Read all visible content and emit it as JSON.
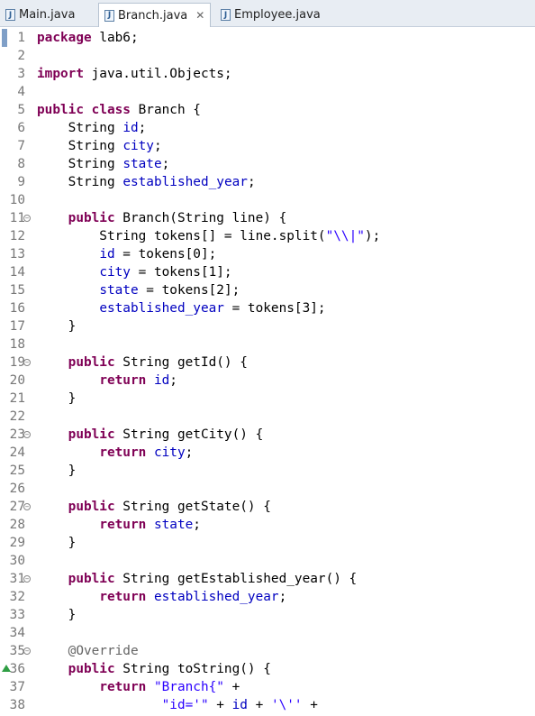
{
  "tabs": [
    {
      "label": "Main.java",
      "active": false
    },
    {
      "label": "Branch.java",
      "active": true,
      "close": "✕"
    },
    {
      "label": "Employee.java",
      "active": false
    }
  ],
  "tab_icon_glyph": "J",
  "lines": [
    {
      "n": "1",
      "parts": [
        {
          "t": "package",
          "c": "kw"
        },
        {
          "t": " lab6;"
        }
      ]
    },
    {
      "n": "2",
      "parts": []
    },
    {
      "n": "3",
      "parts": [
        {
          "t": "import",
          "c": "kw"
        },
        {
          "t": " java.util.Objects;"
        }
      ]
    },
    {
      "n": "4",
      "parts": []
    },
    {
      "n": "5",
      "parts": [
        {
          "t": "public",
          "c": "kw"
        },
        {
          "t": " "
        },
        {
          "t": "class",
          "c": "kw"
        },
        {
          "t": " Branch {"
        }
      ]
    },
    {
      "n": "6",
      "parts": [
        {
          "t": "    String "
        },
        {
          "t": "id",
          "c": "fld"
        },
        {
          "t": ";"
        }
      ]
    },
    {
      "n": "7",
      "parts": [
        {
          "t": "    String "
        },
        {
          "t": "city",
          "c": "fld"
        },
        {
          "t": ";"
        }
      ]
    },
    {
      "n": "8",
      "parts": [
        {
          "t": "    String "
        },
        {
          "t": "state",
          "c": "fld"
        },
        {
          "t": ";"
        }
      ]
    },
    {
      "n": "9",
      "parts": [
        {
          "t": "    String "
        },
        {
          "t": "established_year",
          "c": "fld"
        },
        {
          "t": ";"
        }
      ]
    },
    {
      "n": "10",
      "parts": []
    },
    {
      "n": "11",
      "fold": true,
      "parts": [
        {
          "t": "    "
        },
        {
          "t": "public",
          "c": "kw"
        },
        {
          "t": " Branch(String line) {"
        }
      ]
    },
    {
      "n": "12",
      "parts": [
        {
          "t": "        String tokens[] = line.split("
        },
        {
          "t": "\"\\\\|\"",
          "c": "str"
        },
        {
          "t": ");"
        }
      ]
    },
    {
      "n": "13",
      "parts": [
        {
          "t": "        "
        },
        {
          "t": "id",
          "c": "fld"
        },
        {
          "t": " = tokens[0];"
        }
      ]
    },
    {
      "n": "14",
      "parts": [
        {
          "t": "        "
        },
        {
          "t": "city",
          "c": "fld"
        },
        {
          "t": " = tokens[1];"
        }
      ]
    },
    {
      "n": "15",
      "parts": [
        {
          "t": "        "
        },
        {
          "t": "state",
          "c": "fld"
        },
        {
          "t": " = tokens[2];"
        }
      ]
    },
    {
      "n": "16",
      "parts": [
        {
          "t": "        "
        },
        {
          "t": "established_year",
          "c": "fld"
        },
        {
          "t": " = tokens[3];"
        }
      ]
    },
    {
      "n": "17",
      "parts": [
        {
          "t": "    }"
        }
      ]
    },
    {
      "n": "18",
      "parts": []
    },
    {
      "n": "19",
      "fold": true,
      "parts": [
        {
          "t": "    "
        },
        {
          "t": "public",
          "c": "kw"
        },
        {
          "t": " String getId() {"
        }
      ]
    },
    {
      "n": "20",
      "parts": [
        {
          "t": "        "
        },
        {
          "t": "return",
          "c": "kw"
        },
        {
          "t": " "
        },
        {
          "t": "id",
          "c": "fld"
        },
        {
          "t": ";"
        }
      ]
    },
    {
      "n": "21",
      "parts": [
        {
          "t": "    }"
        }
      ]
    },
    {
      "n": "22",
      "parts": []
    },
    {
      "n": "23",
      "fold": true,
      "parts": [
        {
          "t": "    "
        },
        {
          "t": "public",
          "c": "kw"
        },
        {
          "t": " String getCity() {"
        }
      ]
    },
    {
      "n": "24",
      "parts": [
        {
          "t": "        "
        },
        {
          "t": "return",
          "c": "kw"
        },
        {
          "t": " "
        },
        {
          "t": "city",
          "c": "fld"
        },
        {
          "t": ";"
        }
      ]
    },
    {
      "n": "25",
      "parts": [
        {
          "t": "    }"
        }
      ]
    },
    {
      "n": "26",
      "parts": []
    },
    {
      "n": "27",
      "fold": true,
      "parts": [
        {
          "t": "    "
        },
        {
          "t": "public",
          "c": "kw"
        },
        {
          "t": " String getState() {"
        }
      ]
    },
    {
      "n": "28",
      "parts": [
        {
          "t": "        "
        },
        {
          "t": "return",
          "c": "kw"
        },
        {
          "t": " "
        },
        {
          "t": "state",
          "c": "fld"
        },
        {
          "t": ";"
        }
      ]
    },
    {
      "n": "29",
      "parts": [
        {
          "t": "    }"
        }
      ]
    },
    {
      "n": "30",
      "parts": []
    },
    {
      "n": "31",
      "fold": true,
      "parts": [
        {
          "t": "    "
        },
        {
          "t": "public",
          "c": "kw"
        },
        {
          "t": " String getEstablished_year() {"
        }
      ]
    },
    {
      "n": "32",
      "parts": [
        {
          "t": "        "
        },
        {
          "t": "return",
          "c": "kw"
        },
        {
          "t": " "
        },
        {
          "t": "established_year",
          "c": "fld"
        },
        {
          "t": ";"
        }
      ]
    },
    {
      "n": "33",
      "parts": [
        {
          "t": "    }"
        }
      ]
    },
    {
      "n": "34",
      "parts": []
    },
    {
      "n": "35",
      "fold": true,
      "parts": [
        {
          "t": "    "
        },
        {
          "t": "@Override",
          "c": "ann"
        }
      ]
    },
    {
      "n": "36",
      "override": true,
      "parts": [
        {
          "t": "    "
        },
        {
          "t": "public",
          "c": "kw"
        },
        {
          "t": " String toString() {"
        }
      ]
    },
    {
      "n": "37",
      "parts": [
        {
          "t": "        "
        },
        {
          "t": "return",
          "c": "kw"
        },
        {
          "t": " "
        },
        {
          "t": "\"Branch{\"",
          "c": "str"
        },
        {
          "t": " +"
        }
      ]
    },
    {
      "n": "38",
      "parts": [
        {
          "t": "                "
        },
        {
          "t": "\"id='\"",
          "c": "str"
        },
        {
          "t": " + "
        },
        {
          "t": "id",
          "c": "fld"
        },
        {
          "t": " + "
        },
        {
          "t": "'\\''",
          "c": "str"
        },
        {
          "t": " +"
        }
      ]
    }
  ],
  "colors": {
    "keyword": "#7f0055",
    "field": "#0000c0",
    "string": "#2a00ff",
    "annotation": "#646464"
  }
}
